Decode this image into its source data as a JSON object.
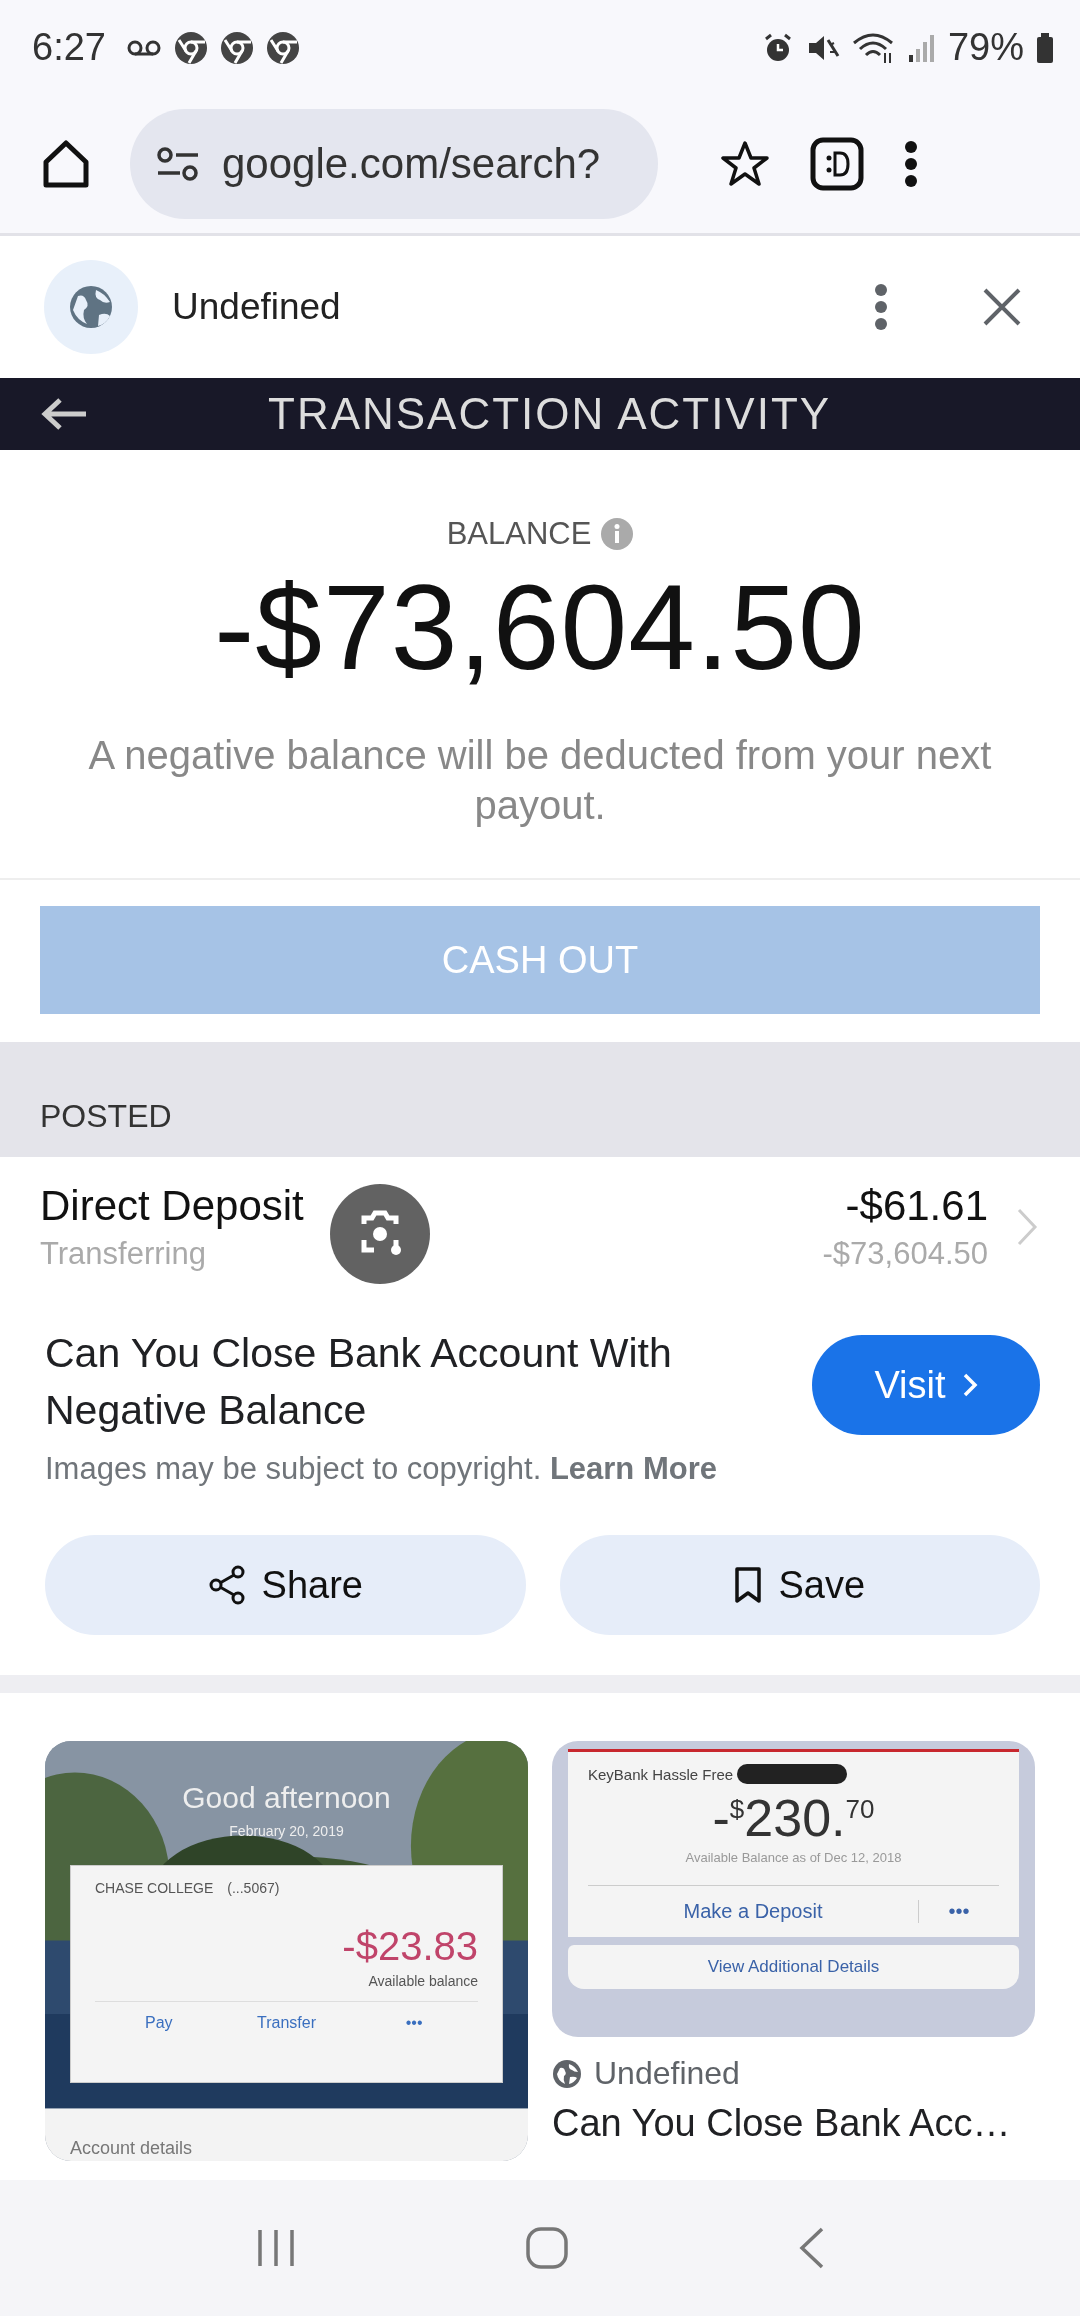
{
  "status_bar": {
    "time": "6:27",
    "battery": "79%"
  },
  "browser": {
    "url": "google.com/search?"
  },
  "source_bar": {
    "site": "Undefined"
  },
  "image": {
    "header": "TRANSACTION ACTIVITY",
    "balance_label": "BALANCE",
    "balance": "-$73,604.50",
    "note": "A negative balance will be deducted from your next payout.",
    "cash_out": {
      "label": "CASH OUT",
      "disabled": true
    },
    "section": "POSTED",
    "transactions": [
      {
        "name": "Direct Deposit",
        "status": "Transferring",
        "amount": "-$61.61",
        "running_balance": "-$73,604.50"
      }
    ]
  },
  "result": {
    "title": "Can You Close Bank Account With Negative Balance",
    "visit": "Visit",
    "copyright": "Images may be subject to copyright.",
    "learn_more": "Learn More",
    "actions": [
      {
        "kind": "share",
        "label": "Share"
      },
      {
        "kind": "save",
        "label": "Save"
      }
    ]
  },
  "related": [
    {
      "greeting": "Good afternoon",
      "date": "February 20, 2019",
      "account": "CHASE COLLEGE",
      "account_number": "(...5067)",
      "balance": "-$23.83",
      "balance_label": "Available balance",
      "actions": [
        "Pay",
        "Transfer",
        "•••"
      ],
      "footer": "Account details"
    },
    {
      "kind": "plain",
      "account": "KeyBank Hassle Free",
      "sign": "-",
      "currency": "$",
      "whole": "230.",
      "cents": "70",
      "note": "Available Balance as of Dec 12, 2018",
      "actions": [
        "Make a Deposit",
        "•••"
      ],
      "details": "View Additional Details",
      "site": "Undefined",
      "title": "Can You Close Bank Acc…"
    }
  ]
}
